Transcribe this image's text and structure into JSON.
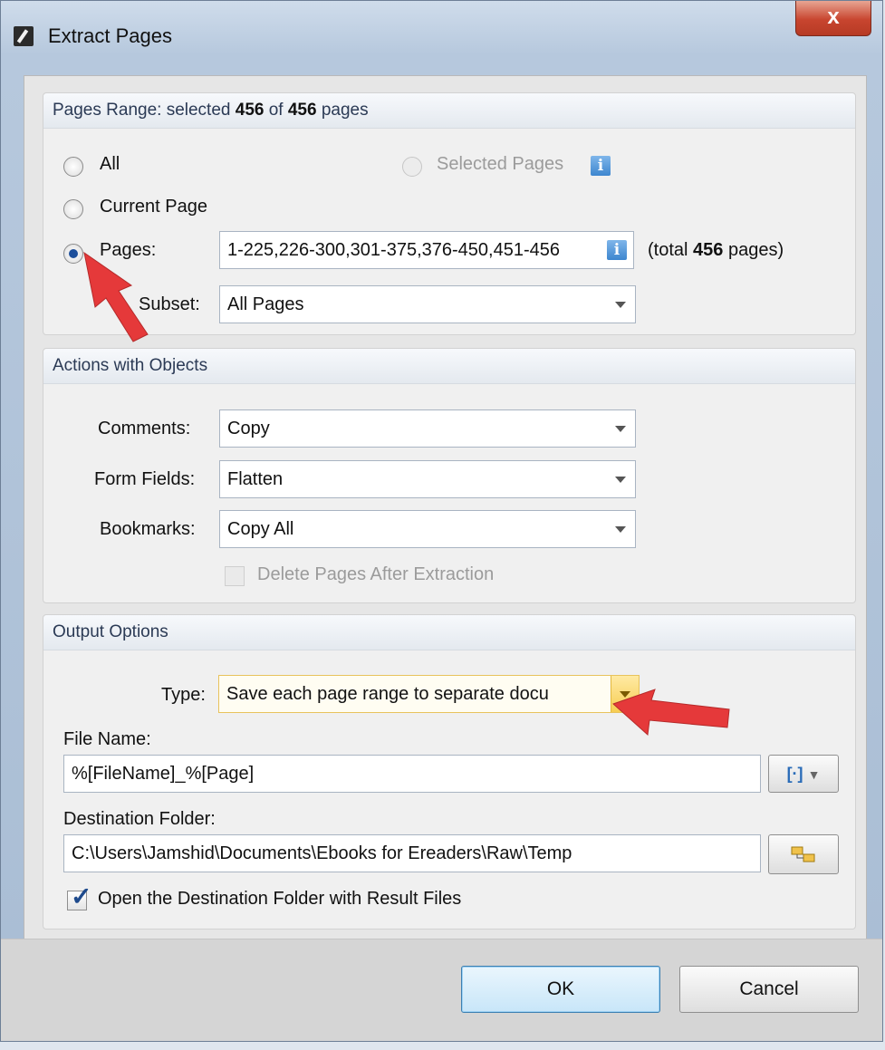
{
  "window": {
    "title": "Extract Pages",
    "close_glyph": "x"
  },
  "pages_range": {
    "header_prefix": "Pages Range: selected ",
    "selected_count": "456",
    "header_of": " of ",
    "total_count": "456",
    "header_suffix": " pages",
    "all_label": "All",
    "selected_pages_label": "Selected Pages",
    "current_page_label": "Current Page",
    "pages_label": "Pages:",
    "pages_value": "1-225,226-300,301-375,376-450,451-456",
    "total_prefix": "(total ",
    "total_value": "456",
    "total_suffix": " pages)",
    "subset_label": "Subset:",
    "subset_value": "All Pages",
    "selected_option": "Pages"
  },
  "actions": {
    "header": "Actions with Objects",
    "comments_label": "Comments:",
    "comments_value": "Copy",
    "form_fields_label": "Form Fields:",
    "form_fields_value": "Flatten",
    "bookmarks_label": "Bookmarks:",
    "bookmarks_value": "Copy All",
    "delete_pages_label": "Delete Pages After Extraction",
    "delete_pages_checked": false
  },
  "output": {
    "header": "Output Options",
    "type_label": "Type:",
    "type_value": "Save each page range to separate docu",
    "file_name_label": "File Name:",
    "file_name_value": "%[FileName]_%[Page]",
    "macro_button_glyph": "[·]",
    "destination_label": "Destination Folder:",
    "destination_value": "C:\\Users\\Jamshid\\Documents\\Ebooks for Ereaders\\Raw\\Temp",
    "open_folder_label": "Open the Destination Folder with Result Files",
    "open_folder_checked": true
  },
  "buttons": {
    "ok": "OK",
    "cancel": "Cancel"
  },
  "colors": {
    "annotation_arrow": "#e5393a",
    "accent": "#1d4f9c"
  },
  "icons": [
    "app-icon",
    "close-icon",
    "info-icon",
    "dropdown-arrow-icon",
    "macro-icon",
    "browse-folder-icon",
    "checkmark-icon",
    "annotation-arrow"
  ]
}
